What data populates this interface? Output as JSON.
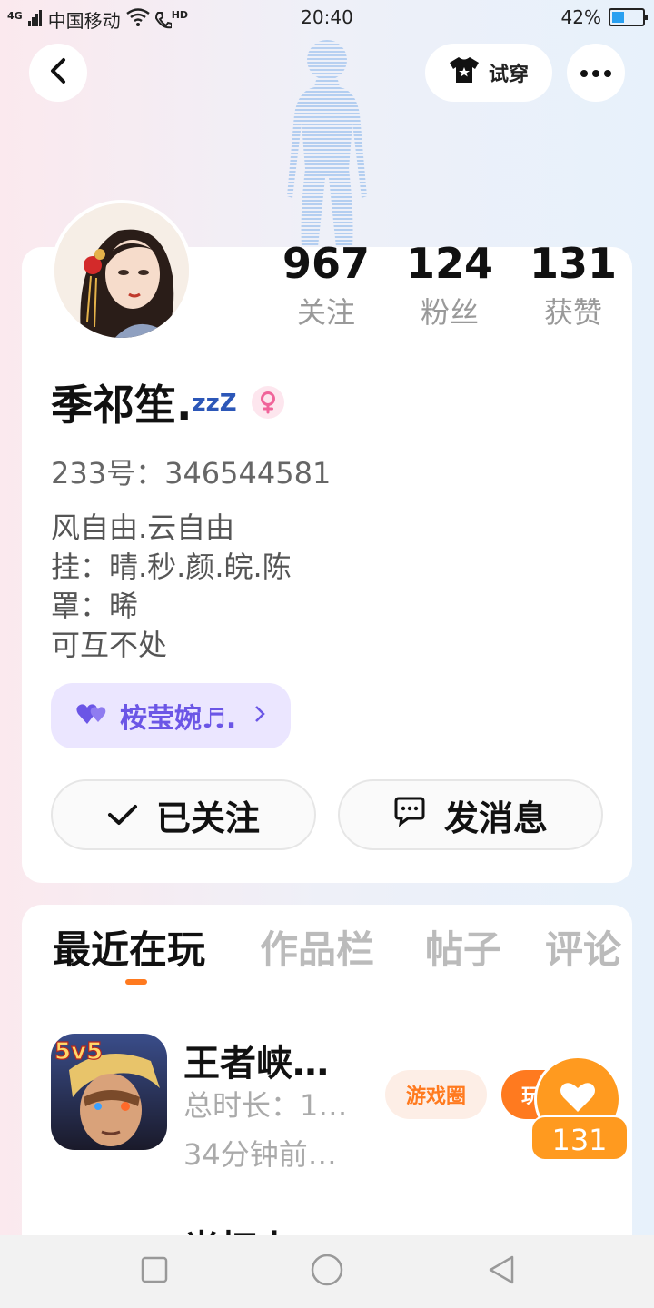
{
  "status_bar": {
    "network": "4G",
    "carrier": "中国移动",
    "hd": "HD",
    "time": "20:40",
    "battery_percent": "42%",
    "battery_level": 0.42
  },
  "header": {
    "tryon_label": "试穿"
  },
  "profile": {
    "stats": [
      {
        "value": "967",
        "label": "关注"
      },
      {
        "value": "124",
        "label": "粉丝"
      },
      {
        "value": "131",
        "label": "获赞"
      }
    ],
    "username": "季祁笙.",
    "username_suffix": "zzZ",
    "gender": "female",
    "uid": "233号：346544581",
    "bio": [
      "风自由.云自由",
      "挂：晴.秒.颜.皖.陈",
      "罩：晞",
      "可互不处"
    ],
    "music_tag": "桉莹婉♬.",
    "follow_button": "已关注",
    "message_button": "发消息"
  },
  "tabs": [
    "最近在玩",
    "作品栏",
    "帖子",
    "评论"
  ],
  "active_tab": 0,
  "games": [
    {
      "name": "王者峡…",
      "duration": "总时长：1…",
      "last_played": "34分钟前…",
      "circle_label": "游戏圈",
      "play_label": "玩",
      "icon_badge": "5v5"
    },
    {
      "name": "光打小"
    }
  ],
  "like_float": {
    "count": "131"
  },
  "colors": {
    "accent": "#ff7a1f",
    "like": "#ff9a1f",
    "music": "#6b56e6",
    "gender": "#f0649a"
  }
}
